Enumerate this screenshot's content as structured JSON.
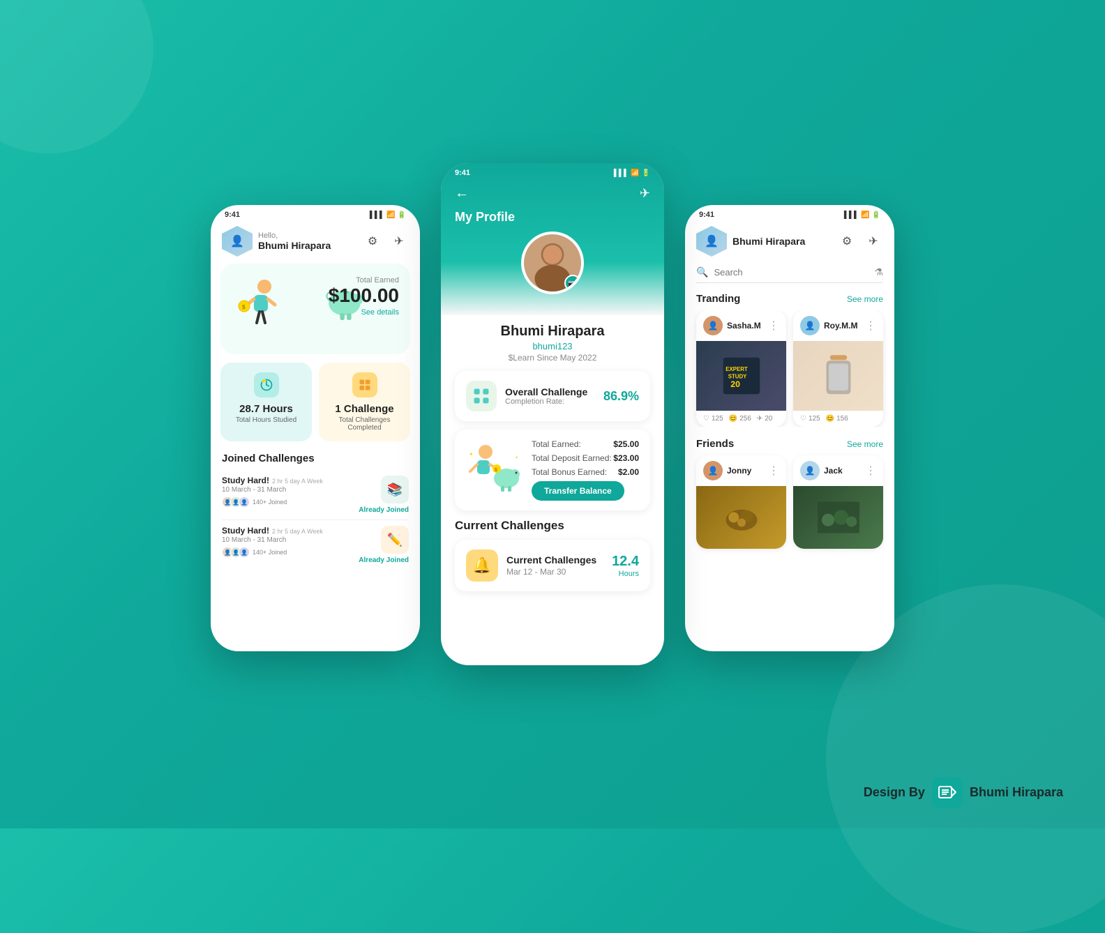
{
  "background": "#0fa89a",
  "phones": {
    "left": {
      "statusBar": {
        "time": "9:41"
      },
      "header": {
        "greeting": "Hello,",
        "name": "Bhumi Hirapara"
      },
      "earnings": {
        "label": "Total Earned",
        "amount": "$100.00",
        "detailLink": "See details"
      },
      "stats": [
        {
          "value": "28.7 Hours",
          "label": "Total Hours Studied",
          "color": "blue"
        },
        {
          "value": "1 Challenge",
          "label": "Total Challenges Completed",
          "color": "yellow"
        }
      ],
      "joinedChallenges": {
        "title": "Joined Challenges",
        "items": [
          {
            "name": "Study Hard!",
            "tag": "2 hr 5 day A Week",
            "dates": "10 March - 31 March",
            "joinedCount": "140+ Joined",
            "status": "Already Joined"
          },
          {
            "name": "Study Hard!",
            "tag": "2 hr 5 day A Week",
            "dates": "10 March - 31 March",
            "joinedCount": "140+ Joined",
            "status": "Already Joined"
          }
        ]
      }
    },
    "center": {
      "statusBar": {
        "time": "9:41"
      },
      "nav": {
        "backIcon": "←",
        "shareIcon": "✈",
        "title": "My Profile"
      },
      "profile": {
        "name": "Bhumi Hirapara",
        "username": "bhumi123",
        "since": "$Learn Since May 2022"
      },
      "overallChallenge": {
        "icon": "🏆",
        "title": "Overall Challenge",
        "subtitle": "Completion Rate:",
        "rate": "86.9%"
      },
      "earnings": {
        "totalEarned": {
          "label": "Total Earned:",
          "value": "$25.00"
        },
        "totalDeposit": {
          "label": "Total Deposit Earned:",
          "value": "$23.00"
        },
        "totalBonus": {
          "label": "Total Bonus Earned:",
          "value": "$2.00"
        },
        "transferBtn": "Transfer Balance"
      },
      "currentChallenges": {
        "sectionTitle": "Current Challenges",
        "item": {
          "icon": "🔔",
          "name": "Current Challenges",
          "dates": "Mar 12 - Mar 30",
          "hours": "12.4",
          "hoursLabel": "Hours"
        }
      }
    },
    "right": {
      "statusBar": {
        "time": "9:41"
      },
      "header": {
        "name": "Bhumi Hirapara"
      },
      "search": {
        "placeholder": "Search"
      },
      "trending": {
        "title": "Tranding",
        "seeMore": "See more",
        "items": [
          {
            "name": "Sasha.M",
            "likes": "125",
            "comments": "256",
            "shares": "20"
          },
          {
            "name": "Roy.M.M",
            "likes": "125",
            "comments": "156",
            "shares": ""
          }
        ]
      },
      "friends": {
        "title": "Friends",
        "seeMore": "See more",
        "items": [
          {
            "name": "Jonny"
          },
          {
            "name": "Jack"
          }
        ]
      }
    }
  },
  "watermark": {
    "prefix": "Design By",
    "name": "Bhumi Hirapara",
    "logoSymbol": "≡D"
  }
}
